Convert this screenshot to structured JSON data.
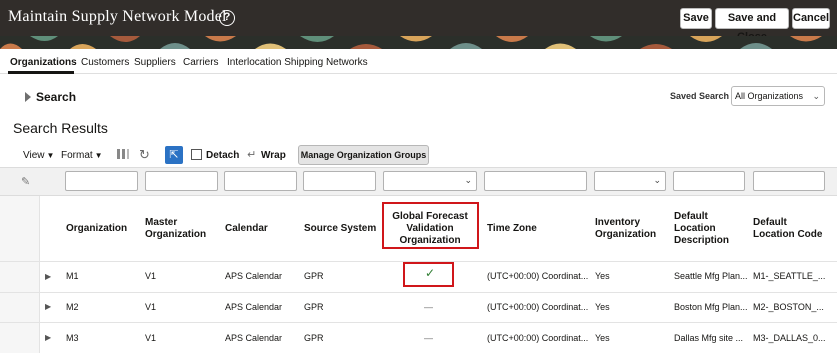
{
  "header": {
    "title": "Maintain Supply Network Model",
    "help_icon": "?",
    "save": "Save",
    "save_and_close": "Save and Close",
    "cancel": "Cancel",
    "bg_color": "#312d2a"
  },
  "tabs": [
    "Organizations",
    "Customers",
    "Suppliers",
    "Carriers",
    "Interlocation Shipping Networks"
  ],
  "search": {
    "label": "Search",
    "saved_search_label": "Saved Search",
    "saved_search_value": "All Organizations"
  },
  "results": {
    "title": "Search Results",
    "toolbar": {
      "view": "View",
      "format": "Format",
      "detach": "Detach",
      "wrap": "Wrap",
      "manage_button": "Manage Organization Groups"
    },
    "columns": {
      "organization": "Organization",
      "master_org_1": "Master",
      "master_org_2": "Organization",
      "calendar": "Calendar",
      "source_system": "Source System",
      "gfv_1": "Global Forecast",
      "gfv_2": "Validation",
      "gfv_3": "Organization",
      "time_zone": "Time Zone",
      "inventory_org_1": "Inventory",
      "inventory_org_2": "Organization",
      "default_loc_desc_1": "Default",
      "default_loc_desc_2": "Location",
      "default_loc_desc_3": "Description",
      "default_loc_code_1": "Default",
      "default_loc_code_2": "Location Code"
    },
    "rows": [
      {
        "org": "M1",
        "master": "V1",
        "calendar": "APS Calendar",
        "source": "GPR",
        "gfv": "✓",
        "tz": "(UTC+00:00) Coordinat...",
        "inv": "Yes",
        "loc_desc": "Seattle Mfg Plan...",
        "loc_code": "M1-_SEATTLE_..."
      },
      {
        "org": "M2",
        "master": "V1",
        "calendar": "APS Calendar",
        "source": "GPR",
        "gfv": "—",
        "tz": "(UTC+00:00) Coordinat...",
        "inv": "Yes",
        "loc_desc": "Boston Mfg Plan...",
        "loc_code": "M2-_BOSTON_..."
      },
      {
        "org": "M3",
        "master": "V1",
        "calendar": "APS Calendar",
        "source": "GPR",
        "gfv": "—",
        "tz": "(UTC+00:00) Coordinat...",
        "inv": "Yes",
        "loc_desc": "Dallas Mfg site ...",
        "loc_code": "M3-_DALLAS_0..."
      }
    ]
  },
  "colors": {
    "highlight": "#d0161a",
    "check": "#2f7d32",
    "freeze_icon": "#2b72c4"
  }
}
